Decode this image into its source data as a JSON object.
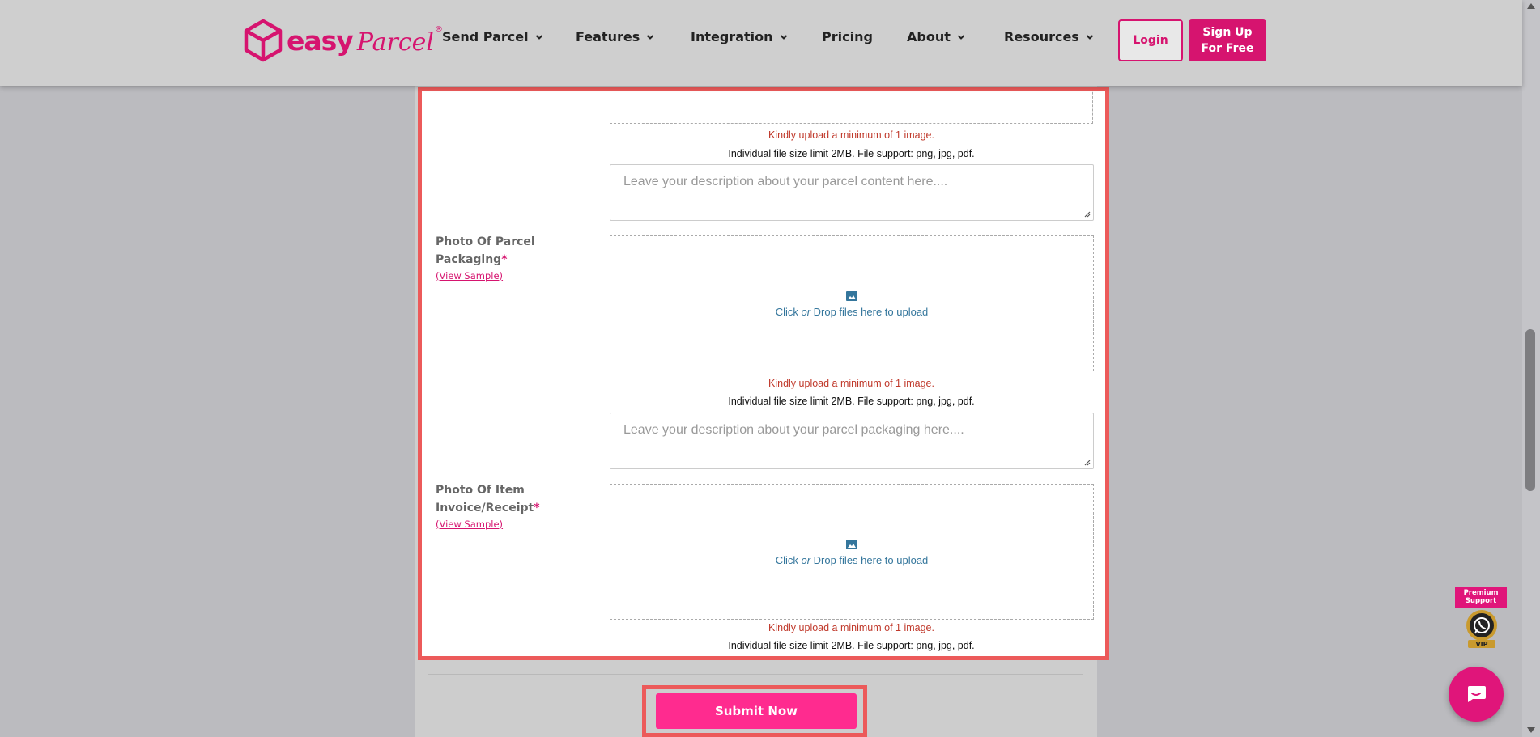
{
  "header": {
    "logo_easy": "easy",
    "logo_parcel": "Parcel",
    "logo_reg": "®",
    "nav": [
      {
        "label": "Send Parcel",
        "has_dropdown": true
      },
      {
        "label": "Features",
        "has_dropdown": true
      },
      {
        "label": "Integration",
        "has_dropdown": true
      },
      {
        "label": "Pricing",
        "has_dropdown": false
      },
      {
        "label": "About",
        "has_dropdown": true
      },
      {
        "label": "Resources",
        "has_dropdown": true
      }
    ],
    "login_label": "Login",
    "signup_line1": "Sign Up",
    "signup_line2": "For Free"
  },
  "form": {
    "content_section": {
      "hint_min": "Kindly upload a minimum of 1 image.",
      "hint_limit": "Individual file size limit 2MB. File support: png, jpg, pdf.",
      "description_placeholder": "Leave your description about your parcel content here...."
    },
    "packaging_section": {
      "label_line1": "Photo Of Parcel",
      "label_line2": "Packaging",
      "required_mark": "*",
      "view_sample": "(View Sample)",
      "upload_text_a": "Click ",
      "upload_text_or": "or",
      "upload_text_b": " Drop files here to upload",
      "hint_min": "Kindly upload a minimum of 1 image.",
      "hint_limit": "Individual file size limit 2MB. File support: png, jpg, pdf.",
      "description_placeholder": "Leave your description about your parcel packaging here...."
    },
    "invoice_section": {
      "label_line1": "Photo Of Item",
      "label_line2": "Invoice/Receipt",
      "required_mark": "*",
      "view_sample": "(View Sample)",
      "upload_text_a": "Click ",
      "upload_text_or": "or",
      "upload_text_b": " Drop files here to upload",
      "hint_min": "Kindly upload a minimum of 1 image.",
      "hint_limit": "Individual file size limit 2MB. File support: png, jpg, pdf."
    },
    "submit_label": "Submit Now"
  },
  "premium_support": {
    "line1": "Premium",
    "line2": "Support",
    "badge_text": "VIP"
  },
  "colors": {
    "brand": "#d6146f",
    "submit": "#ff2b8f",
    "highlight": "#ec5a5a",
    "upload_link": "#34769c",
    "error": "#c0392b"
  }
}
